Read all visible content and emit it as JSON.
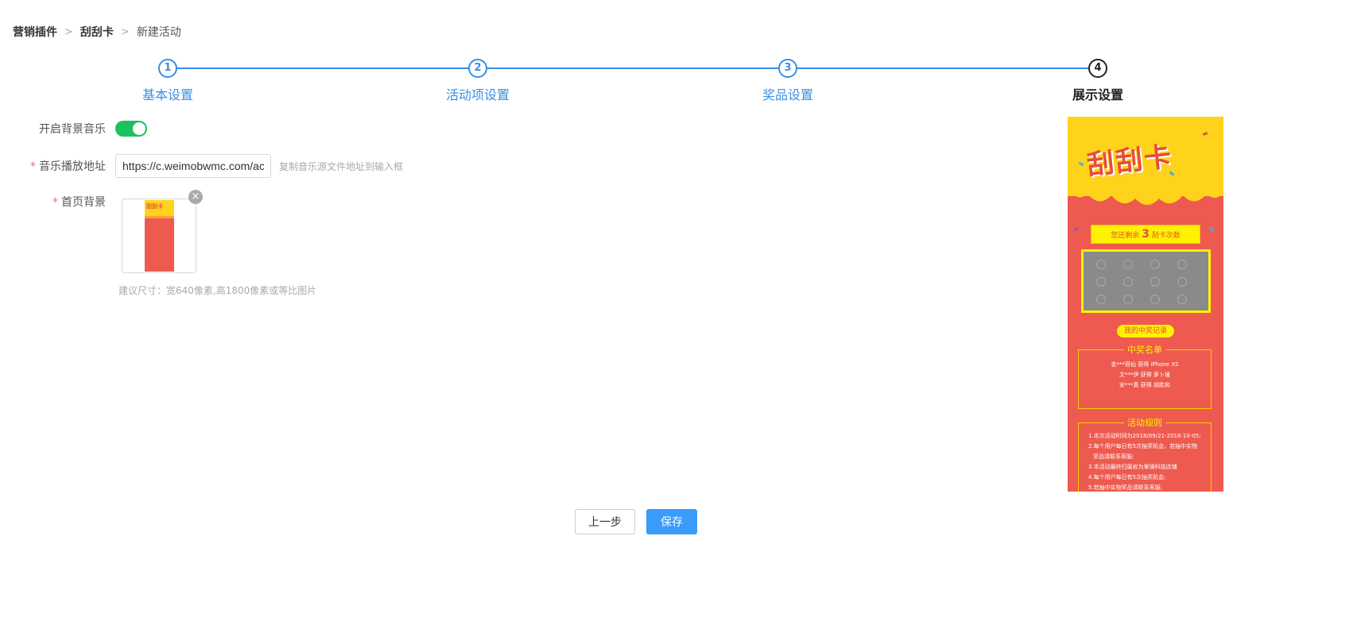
{
  "breadcrumb": [
    {
      "label": "营销插件"
    },
    {
      "label": "刮刮卡"
    },
    {
      "label": "新建活动"
    }
  ],
  "steps": [
    {
      "number": "1",
      "label": "基本设置"
    },
    {
      "number": "2",
      "label": "活动项设置"
    },
    {
      "number": "3",
      "label": "奖品设置"
    },
    {
      "number": "4",
      "label": "展示设置"
    }
  ],
  "form": {
    "music_label": "开启背景音乐",
    "music_enabled": true,
    "url_label": "音乐播放地址",
    "url_value": "https://c.weimobwmc.com/activi",
    "url_hint": "复制音乐源文件地址到输入框",
    "bg_label": "首页背景",
    "required_mark": "*",
    "size_hint": "建议尺寸：宽640像素,高1800像素或等比图片",
    "thumb_title": "刮刮卡"
  },
  "preview": {
    "title": "刮刮卡",
    "remain_prefix": "您还剩余",
    "remain_count": "3",
    "remain_suffix": "刮卡次数",
    "record_button": "我的中奖记录",
    "winners_title": "中奖名单",
    "winners": [
      "金***容仙 获得 iPhone XS",
      "文***伊 获得 萝卜锤",
      "安***真 获得 胡胜和"
    ],
    "rules_title": "活动规则",
    "rules": [
      "1.本次活动时间为2018/09/21-2018-10-05;",
      "2.每个用户每日有5次抽奖机会，若抽中实物",
      "奖品请联系客服;",
      "3.本活动最终归属权为掌骑科技店铺",
      "4.每个用户每日有5次抽奖机会;",
      "5.若抽中实物奖品请联系客服;"
    ]
  },
  "buttons": {
    "prev": "上一步",
    "save": "保存"
  },
  "colors": {
    "accent": "#3a8ee6",
    "switch_on": "#1ac15c",
    "save_button": "#3a9bfa",
    "preview_red": "#ee5a4f",
    "preview_yellow": "#ffd21b"
  }
}
